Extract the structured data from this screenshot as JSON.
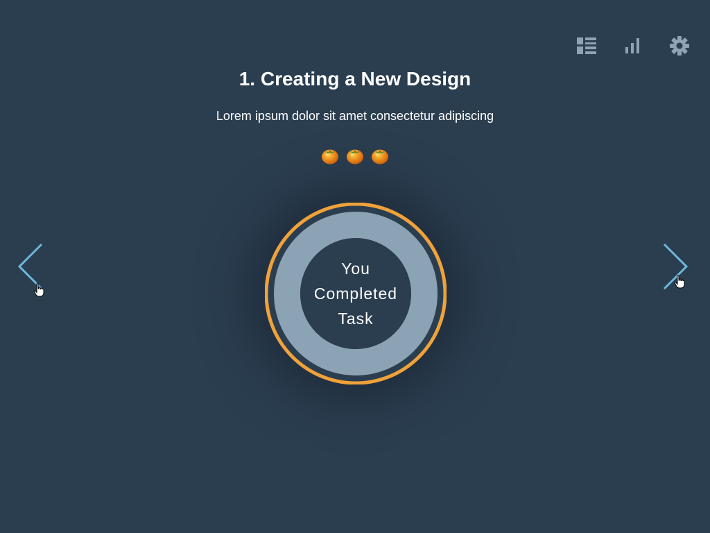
{
  "toolbar": {
    "items": [
      {
        "icon": "list-view-icon"
      },
      {
        "icon": "bar-chart-icon"
      },
      {
        "icon": "gear-icon"
      }
    ],
    "icon_color": "#8ea3b5"
  },
  "task": {
    "title": "1. Creating a New Design",
    "description": "Lorem ipsum dolor sit amet consectetur adipiscing",
    "tomato_count": 3
  },
  "progress": {
    "line1": "You",
    "line2": "Completed",
    "line3": "Task",
    "fraction": 1.0
  },
  "colors": {
    "background": "#2b3e50",
    "ring_outer": "#f0a23a",
    "ring_inner": "#8ca2b5",
    "arrow": "#6fb8dc"
  }
}
